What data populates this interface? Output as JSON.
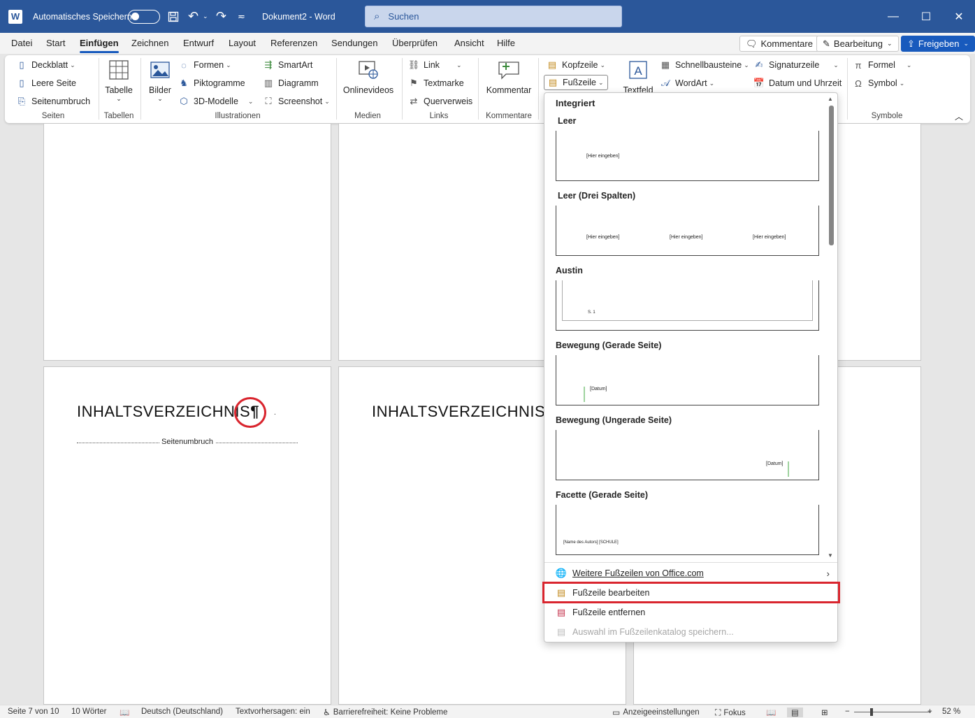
{
  "window": {
    "autosave_label": "Automatisches Speichern",
    "doc_title": "Dokument2  -  Word",
    "search_placeholder": "Suchen"
  },
  "menu": {
    "tabs": [
      "Datei",
      "Start",
      "Einfügen",
      "Zeichnen",
      "Entwurf",
      "Layout",
      "Referenzen",
      "Sendungen",
      "Überprüfen",
      "Ansicht",
      "Hilfe"
    ],
    "active_tab": "Einfügen",
    "comments_button": "Kommentare",
    "editing_button": "Bearbeitung",
    "share_button": "Freigeben"
  },
  "ribbon": {
    "seiten": {
      "deckblatt": "Deckblatt",
      "leere_seite": "Leere Seite",
      "seitenumbruch": "Seitenumbruch",
      "group": "Seiten"
    },
    "tabellen": {
      "tabelle": "Tabelle",
      "group": "Tabellen"
    },
    "illustrationen": {
      "bilder": "Bilder",
      "formen": "Formen",
      "piktogramme": "Piktogramme",
      "modelle": "3D-Modelle",
      "smartart": "SmartArt",
      "diagramm": "Diagramm",
      "screenshot": "Screenshot",
      "group": "Illustrationen"
    },
    "medien": {
      "onlinevideos": "Onlinevideos",
      "group": "Medien"
    },
    "links": {
      "link": "Link",
      "textmarke": "Textmarke",
      "querverweis": "Querverweis",
      "group": "Links"
    },
    "kommentare": {
      "kommentar": "Kommentar",
      "group": "Kommentare"
    },
    "kopf": {
      "kopfzeile": "Kopfzeile",
      "fusszeile": "Fußzeile"
    },
    "text": {
      "textfeld": "Textfeld",
      "schnellbausteine": "Schnellbausteine",
      "wordart": "WordArt",
      "signaturzeile": "Signaturzeile",
      "datum": "Datum und Uhrzeit"
    },
    "symbole": {
      "formel": "Formel",
      "symbol": "Symbol",
      "group": "Symbole"
    }
  },
  "document": {
    "heading_left": "INHALTSVERZEICHNIS",
    "pilcrow": "¶",
    "page_break": "Seitenumbruch",
    "heading_right": "INHALTSVERZEICHNIS"
  },
  "dropdown": {
    "section": "Integriert",
    "gallery": [
      {
        "title": "Leer",
        "placeholders": [
          "[Hier eingeben]"
        ]
      },
      {
        "title": "Leer (Drei Spalten)",
        "placeholders": [
          "[Hier eingeben]",
          "[Hier eingeben]",
          "[Hier eingeben]"
        ]
      },
      {
        "title": "Austin",
        "placeholders": [
          "S. 1"
        ]
      },
      {
        "title": "Bewegung (Gerade Seite)",
        "placeholders": [
          "[Datum]"
        ]
      },
      {
        "title": "Bewegung (Ungerade Seite)",
        "placeholders": [
          "[Datum]"
        ]
      },
      {
        "title": "Facette (Gerade Seite)",
        "placeholders": [
          "[Name des Autors] [SCHULE]"
        ]
      }
    ],
    "actions": [
      {
        "label": "Weitere Fußzeilen von Office.com",
        "icon": "globe-icon"
      },
      {
        "label": "Fußzeile bearbeiten",
        "icon": "footer-edit-icon"
      },
      {
        "label": "Fußzeile entfernen",
        "icon": "footer-remove-icon"
      },
      {
        "label": "Auswahl im Fußzeilenkatalog speichern...",
        "icon": "footer-save-icon",
        "disabled": true
      }
    ]
  },
  "status": {
    "page": "Seite 7 von 10",
    "words": "10 Wörter",
    "language": "Deutsch (Deutschland)",
    "predictions": "Textvorhersagen: ein",
    "accessibility": "Barrierefreiheit: Keine Probleme",
    "display_settings": "Anzeigeeinstellungen",
    "focus": "Fokus",
    "zoom": "52 %"
  },
  "colors": {
    "title_bar": "#2b579a",
    "accent": "#185abd",
    "highlight": "#d9252e"
  }
}
